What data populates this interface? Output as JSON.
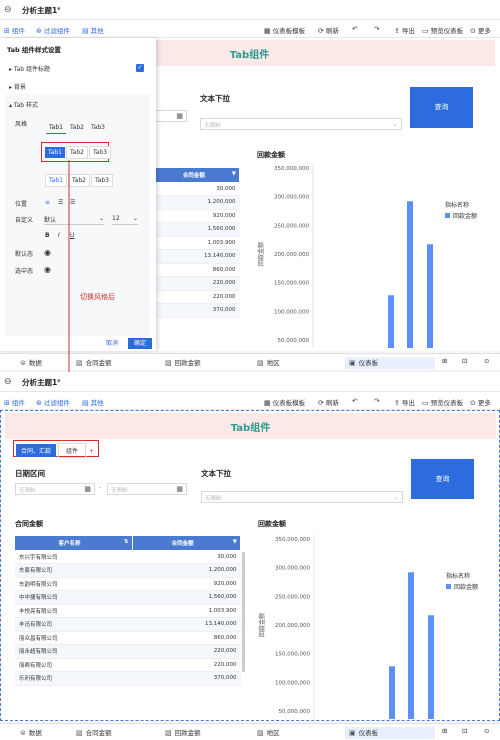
{
  "titlebar": {
    "theme": "分析主题1",
    "theme_caret": "▾"
  },
  "toolbar": {
    "component": "组件",
    "filter": "过滤组件",
    "other": "其他",
    "template": "仪表板模板",
    "refresh": "刷新",
    "export": "导出",
    "preview": "预览仪表板",
    "more": "更多"
  },
  "dashboard": {
    "tab_component_title": "Tab组件",
    "date_range_label": "日期区间",
    "date_placeholder": "无限制",
    "date_sep": "-",
    "text_dropdown_label": "文本下拉",
    "dropdown_placeholder": "无限制",
    "query_button": "查询",
    "contract_title": "合同金额",
    "collection_title": "回款金额",
    "tab_items": [
      "合同、汇款",
      "组件"
    ],
    "add_tab": "+"
  },
  "table": {
    "col_customer": "客户名称",
    "col_amount": "合同金额",
    "sort_icon": "⇅",
    "dd_icon": "▼",
    "rows": [
      {
        "name": "东兴宇有限公司",
        "amount": "30,000"
      },
      {
        "name": "东套有限公司",
        "amount": "1,200,000"
      },
      {
        "name": "东韵明有限公司",
        "amount": "920,000"
      },
      {
        "name": "中中捷有限公司",
        "amount": "1,560,000"
      },
      {
        "name": "丰悦亮有限公司",
        "amount": "1,003,900"
      },
      {
        "name": "丰迅有限公司",
        "amount": "13,140,000"
      },
      {
        "name": "丽众昌有限公司",
        "amount": "860,000"
      },
      {
        "name": "丽永超有限公司",
        "amount": "220,000"
      },
      {
        "name": "丽卿有限公司",
        "amount": "220,000"
      },
      {
        "name": "乐利有限公司",
        "amount": "370,000"
      }
    ]
  },
  "chart_data": {
    "type": "bar",
    "title": "回款金额",
    "ylabel": "回款金额",
    "legend_title": "指标名称",
    "legend_item": "回款金额",
    "y_ticks": [
      "350,000,000",
      "300,000,000",
      "250,000,000",
      "200,000,000",
      "150,000,000",
      "100,000,000",
      "50,000,000"
    ],
    "ylim_visible": [
      50000000,
      350000000
    ],
    "values": [
      128000000,
      292000000,
      217000000
    ],
    "color": "#5b8ff9"
  },
  "panel": {
    "title": "Tab 组件样式设置",
    "title_toggle": "Tab 组件标题",
    "background": "背景",
    "tab_style": "Tab 样式",
    "style_label": "风格",
    "tabs": [
      "Tab1",
      "Tab2",
      "Tab3"
    ],
    "position_label": "位置",
    "custom_label": "自定义",
    "font_default": "默认",
    "font_size": "12",
    "bold": "B",
    "italic": "I",
    "underline": "U",
    "default_state": "默认态",
    "selected_state": "选中态",
    "cancel": "取消",
    "confirm": "确定",
    "align_left": "≡",
    "align_center": "☰",
    "align_right": "☰"
  },
  "annotation": {
    "text": "切换风格后"
  },
  "bottom_tabs": [
    "数据",
    "合同金额",
    "回款金额",
    "地区",
    "仪表板"
  ]
}
